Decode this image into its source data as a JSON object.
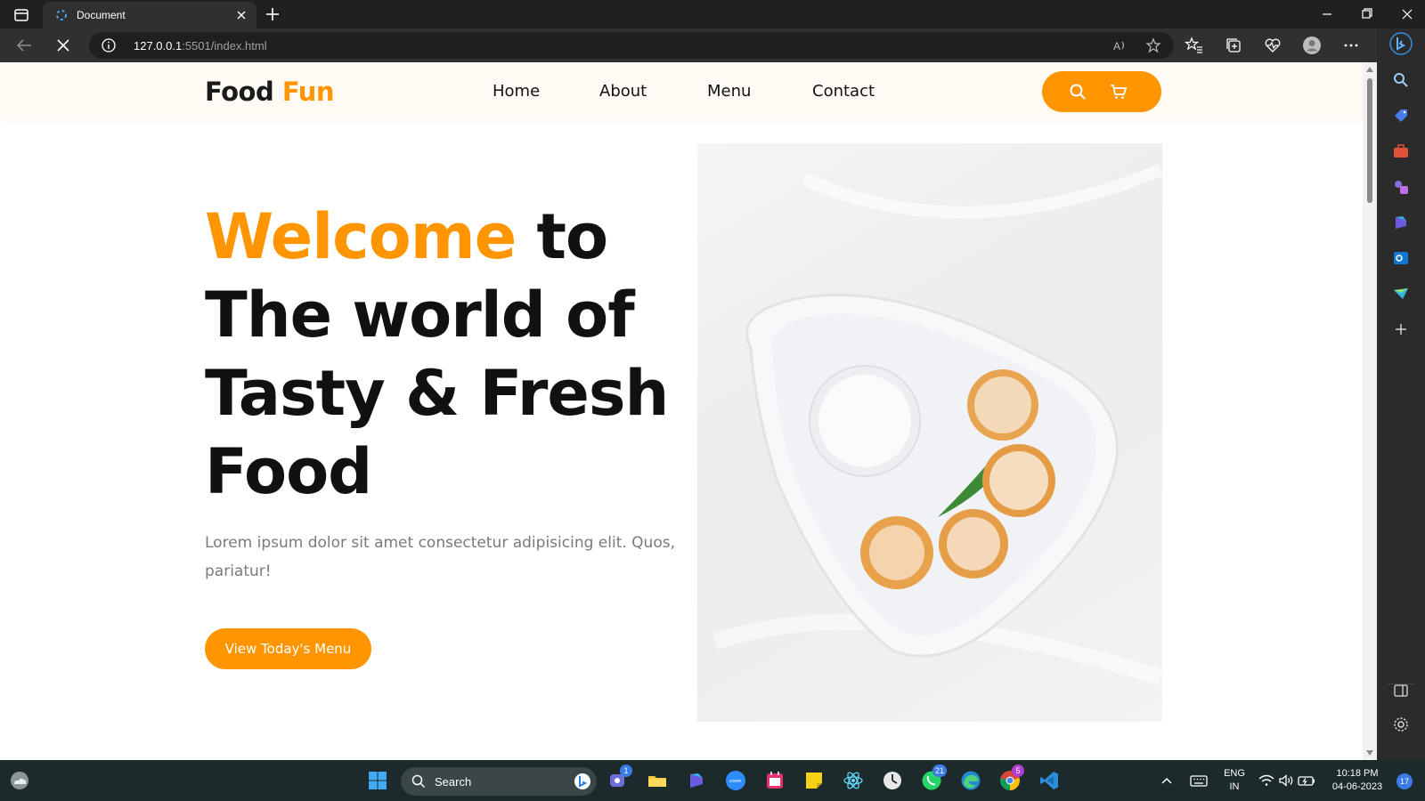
{
  "browser": {
    "tab_title": "Document",
    "url_host": "127.0.0.1",
    "url_rest": ":5501/index.html"
  },
  "site": {
    "logo_main": "Food",
    "logo_accent": "Fun",
    "nav": [
      "Home",
      "About",
      "Menu",
      "Contact"
    ],
    "hero": {
      "title_accent": "Welcome",
      "title_line1_rest": " to",
      "title_line2": "The world of",
      "title_line3": "Tasty & Fresh",
      "title_line4": "Food",
      "description": "Lorem ipsum dolor sit amet consectetur adipisicing elit. Quos, pariatur!",
      "button": "View Today's Menu"
    },
    "accent_color": "#ff9500"
  },
  "taskbar": {
    "search_label": "Search",
    "teams_badge": "1",
    "whatsapp_badge": "21",
    "chrome_badge": "5",
    "lang_line1": "ENG",
    "lang_line2": "IN",
    "time": "10:18 PM",
    "date": "04-06-2023",
    "notification_count": "17"
  }
}
